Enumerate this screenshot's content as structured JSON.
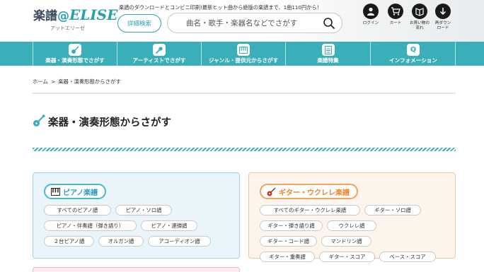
{
  "header": {
    "logo_main": "楽譜@ELISE",
    "logo_sub": "アットエリーゼ",
    "tagline": "楽譜のダウンロードとコンビニ印刷!最新ヒット曲から絶版の楽譜まで、1曲110円から！",
    "detail_search_label": "詳細検索",
    "search_placeholder": "曲名・歌手・楽器名などでさがす",
    "icons": [
      {
        "name": "login-icon",
        "label": "ログイン"
      },
      {
        "name": "cart-icon",
        "label": "カート"
      },
      {
        "name": "purchase-flow-icon",
        "label": "お買い物の\n流れ"
      },
      {
        "name": "redownload-icon",
        "label": "再ダウン\nロード"
      }
    ]
  },
  "nav": {
    "items": [
      {
        "label": "楽器・演奏形態でさがす",
        "icon": "guitar-icon"
      },
      {
        "label": "アーティストでさがす",
        "icon": "microphone-icon"
      },
      {
        "label": "ジャンル・提供元からさがす",
        "icon": "keyboard-icon"
      },
      {
        "label": "楽譜特集",
        "icon": "score-icon"
      },
      {
        "label": "インフォメーション",
        "icon": "q-icon",
        "glyph": "Q"
      }
    ]
  },
  "breadcrumb": {
    "home": "ホーム",
    "sep": ">",
    "current": "楽器・演奏形態からさがす"
  },
  "page_title": "楽器・演奏形態からさがす",
  "categories": [
    {
      "title": "ピアノ楽譜",
      "icon": "piano-icon",
      "tags": [
        "すべてのピアノ譜",
        "ピアノ・ソロ譜",
        "ピアノ・伴奏譜（弾き語り）",
        "ピアノ・連弾譜",
        "２台ピアノ譜",
        "オルガン譜",
        "アコーディオン譜"
      ]
    },
    {
      "title": "ギター・ウクレレ楽譜",
      "icon": "guitar-icon",
      "tags": [
        "すべてのギター・ウクレレ楽譜",
        "ギター・ソロ譜",
        "ギター・弾き語り譜",
        "ウクレレ譜",
        "ギター・コード譜",
        "マンドリン譜",
        "ギター・重奏譜",
        "ギター・スコア",
        "ベース・スコア"
      ]
    }
  ],
  "colors": {
    "accent": "#3aafb9",
    "piano_bg": "#eaf5fb",
    "piano_border": "#49b6d6",
    "guitar_bg": "#fdf4ec",
    "guitar_border": "#f0a45a"
  }
}
